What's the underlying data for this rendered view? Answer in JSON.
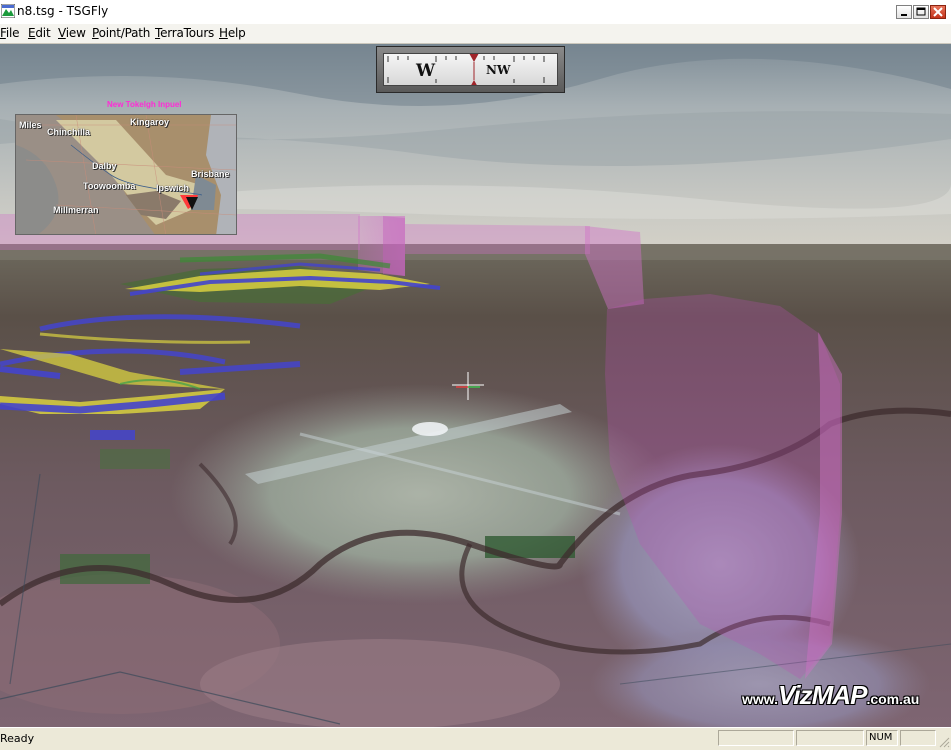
{
  "window": {
    "title": "n8.tsg - TSGFly",
    "controls": [
      "minimize-icon",
      "maximize-icon",
      "close-icon"
    ]
  },
  "menu": [
    "File",
    "Edit",
    "View",
    "Point/Path",
    "TerraTours",
    "Help"
  ],
  "compass": {
    "heading_left": "W",
    "heading_right": "NW"
  },
  "inset_map": {
    "title": "New Tokelgh Inpuel",
    "places": [
      "Miles",
      "Chinchilla",
      "Kingaroy",
      "Dalby",
      "Toowoomba",
      "Brisbane",
      "Ipswich",
      "Millmerran"
    ]
  },
  "watermark": {
    "prefix": "www.",
    "brand": "VizMAP",
    "suffix": ".com.au"
  },
  "status": {
    "text": "Ready",
    "indicator": "NUM"
  },
  "colors": {
    "corridor_pink": "#d070c8",
    "flight_path_yellow": "#d8d040",
    "flight_path_blue": "#4444cc",
    "inset_place_color": "#ffffff",
    "inset_title_color": "#ff2bd6"
  }
}
